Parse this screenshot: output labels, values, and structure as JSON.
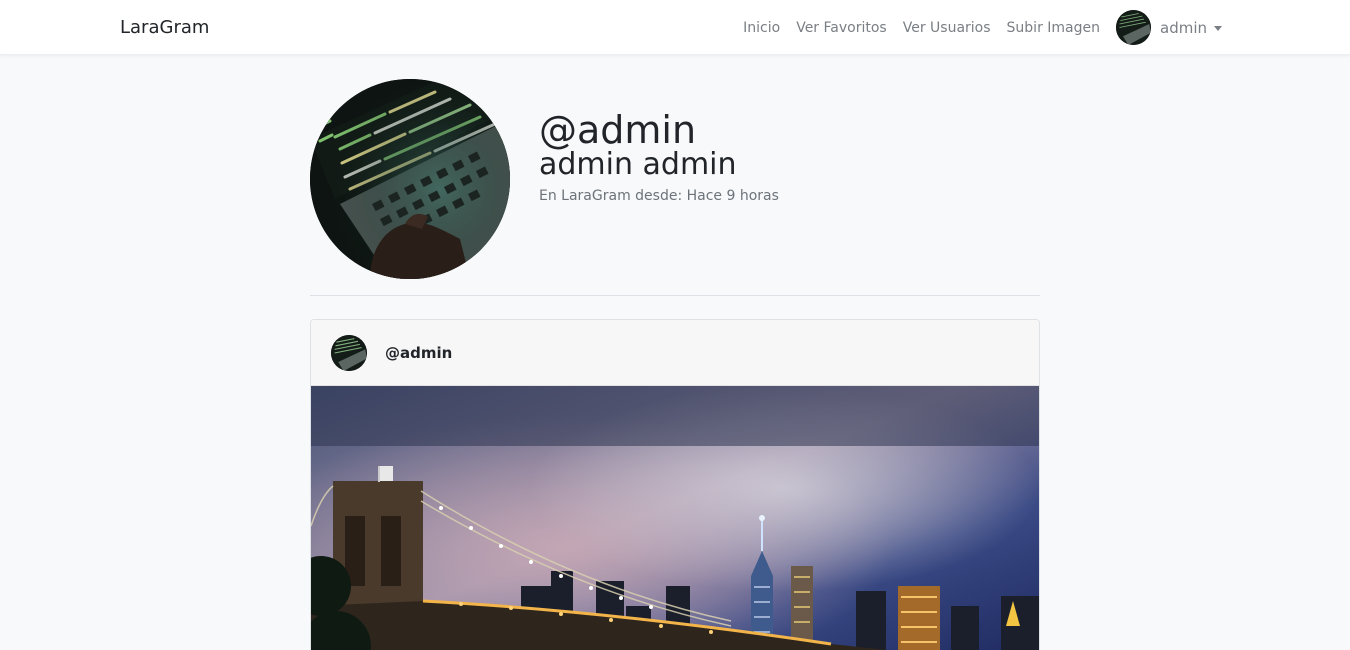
{
  "navbar": {
    "brand": "LaraGram",
    "links": [
      "Inicio",
      "Ver Favoritos",
      "Ver Usuarios",
      "Subir Imagen"
    ],
    "user_name": "admin",
    "user_avatar_icon": "laptop-code-avatar"
  },
  "profile": {
    "nick": "@admin",
    "full_name": "admin admin",
    "since": "En LaraGram desde: Hace 9 horas",
    "avatar_icon": "laptop-code-avatar"
  },
  "post": {
    "user": "@admin",
    "image_icon": "brooklyn-bridge-night-photo"
  },
  "colors": {
    "page_bg": "#f8f9fa",
    "navbar_bg": "#ffffff",
    "nav_text": "#7a7f85",
    "card_header_bg": "#f7f7f7"
  }
}
